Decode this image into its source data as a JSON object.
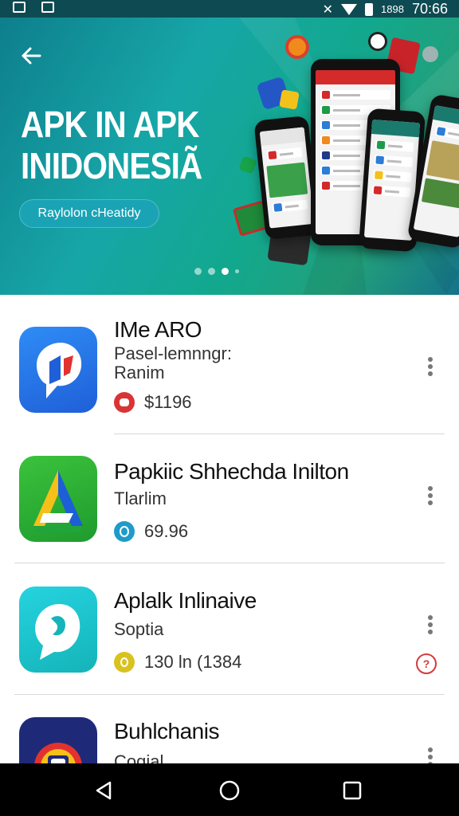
{
  "status_bar": {
    "text": "1898",
    "time": "70:66"
  },
  "hero": {
    "title_line1": "APK IN  APK",
    "title_line2": "INIDONESIÃ",
    "pill_label": "Raylolon cHeatidy",
    "dots": 4,
    "active_dot": 2
  },
  "apps": [
    {
      "name": "IMe ARO",
      "sub1": "Pasel-lemnngr:",
      "sub2": "Ranim",
      "meta_text": "$1196",
      "badge_color": "#d93434",
      "icon": "blue-chat-app-icon"
    },
    {
      "name": "Papkiic Shhechda Inilton",
      "sub1": "Tlarlim",
      "meta_text": "69.96",
      "badge_color": "#1e9bc9",
      "icon": "green-a-app-icon"
    },
    {
      "name": "Aplalk Inlinaive",
      "sub1": "Soptia",
      "meta_text": "130 ln (1384",
      "badge_color": "#d9c21f",
      "icon": "teal-chat-app-icon"
    },
    {
      "name": "Buhlchanis",
      "sub1": "Cogial",
      "icon": "navy-camera-app-icon"
    }
  ],
  "colors": {
    "hero_start": "#0d7f8c",
    "hero_end": "#22a07a",
    "accent_red": "#d42a2a"
  }
}
